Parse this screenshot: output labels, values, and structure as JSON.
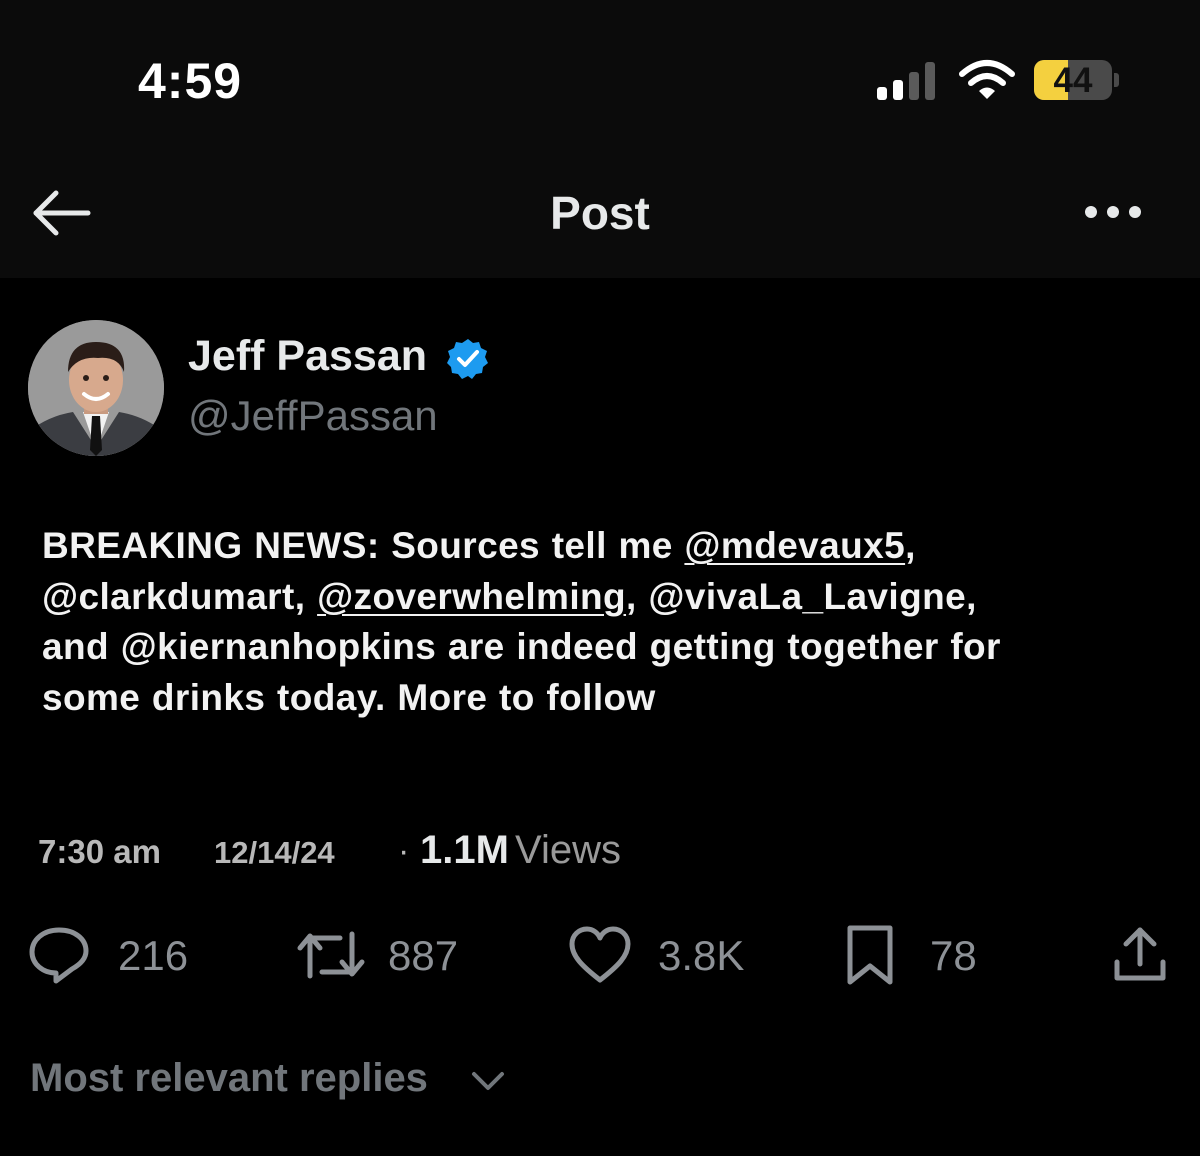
{
  "status_bar": {
    "time": "4:59",
    "battery_level": "44",
    "battery_fraction": 0.44,
    "icons": [
      "cellular-signal-icon",
      "wifi-icon",
      "battery-icon"
    ]
  },
  "nav": {
    "title": "Post",
    "back_icon": "arrow-left-icon",
    "more_icon": "more-horizontal-icon"
  },
  "author": {
    "name": "Jeff Passan",
    "handle": "@JeffPassan",
    "verified": true,
    "verified_color": "#1d9bf0"
  },
  "tweet": {
    "lines": [
      {
        "t1": "BREAKING NEWS: Sources tell me ",
        "m1": "@mdevaux5",
        "t2": ","
      },
      {
        "m1": "@clarkdumart",
        "t1": ", ",
        "m2": "@zoverwhelming",
        "t2": ", ",
        "m3": "@vivaLa_Lavigne",
        "t3": ","
      },
      {
        "t1": "and ",
        "m1": "@kiernanhopkins",
        "t2": " are indeed getting together for"
      },
      {
        "t1": "some drinks today. More to follow"
      }
    ]
  },
  "meta": {
    "time": "7:30 am",
    "date": "12/14/24",
    "separator": "·",
    "views_count": "1.1M",
    "views_label": "Views"
  },
  "actions": {
    "replies": "216",
    "reposts": "887",
    "likes": "3.8K",
    "bookmarks": "78",
    "icons": [
      "reply-icon",
      "repost-icon",
      "like-icon",
      "bookmark-icon",
      "share-icon"
    ]
  },
  "replies_filter": {
    "label": "Most relevant replies",
    "icon": "chevron-down-icon"
  },
  "colors": {
    "background": "#000000",
    "header_background": "#0b0b0b",
    "text_primary": "#e7e9ea",
    "text_secondary": "#71767b",
    "battery_fill": "#f4d03f",
    "verified": "#1d9bf0"
  }
}
